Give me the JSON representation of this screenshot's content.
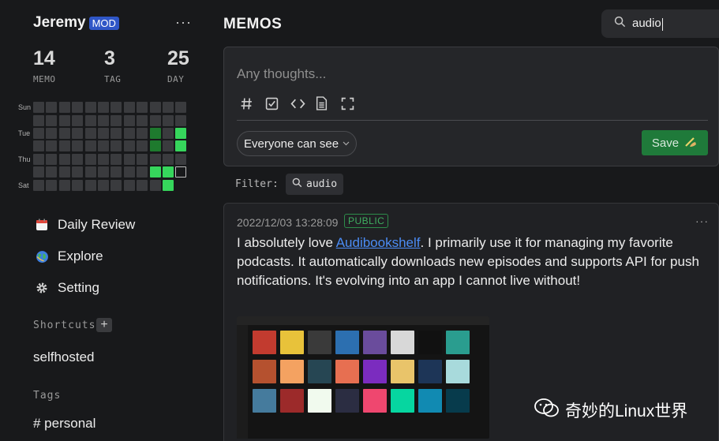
{
  "sidebar": {
    "username": "Jeremy",
    "badge": "MOD",
    "more": "···",
    "stats": [
      {
        "value": "14",
        "label": "MEMO"
      },
      {
        "value": "3",
        "label": "TAG"
      },
      {
        "value": "25",
        "label": "DAY"
      }
    ],
    "heatmap_day_labels": [
      "Sun",
      "",
      "Tue",
      "",
      "Thu",
      "",
      "Sat"
    ],
    "nav": [
      {
        "label": "Daily Review",
        "icon": "calendar-icon"
      },
      {
        "label": "Explore",
        "icon": "globe-icon"
      },
      {
        "label": "Setting",
        "icon": "gear-icon"
      }
    ],
    "shortcuts_title": "Shortcuts",
    "shortcut_add": "+",
    "shortcuts": [
      "selfhosted"
    ],
    "tags_title": "Tags",
    "tags": [
      "# personal"
    ]
  },
  "header": {
    "title": "MEMOS",
    "search_value": "audio"
  },
  "editor": {
    "placeholder": "Any thoughts...",
    "toolbar": [
      "hash-icon",
      "checkbox-icon",
      "code-icon",
      "document-icon",
      "fullscreen-icon"
    ],
    "visibility": "Everyone can see",
    "save_label": "Save",
    "save_emoji": "✍️"
  },
  "filter": {
    "label": "Filter:",
    "chip": "audio"
  },
  "memo": {
    "timestamp": "2022/12/03 13:28:09",
    "visibility": "PUBLIC",
    "more": "···",
    "text_before": "I absolutely love ",
    "link_text": "Audibookshelf",
    "text_after": ". I primarily use it for managing my favorite podcasts. It automatically downloads new episodes and supports API for push notifications. It's evolving into an app I cannot live without!"
  },
  "watermark": "奇妙的Linux世界",
  "colors": {
    "accent_green": "#36d65c",
    "link": "#4b8cf5",
    "badge": "#2f56c7",
    "save": "#1f7a3a"
  }
}
